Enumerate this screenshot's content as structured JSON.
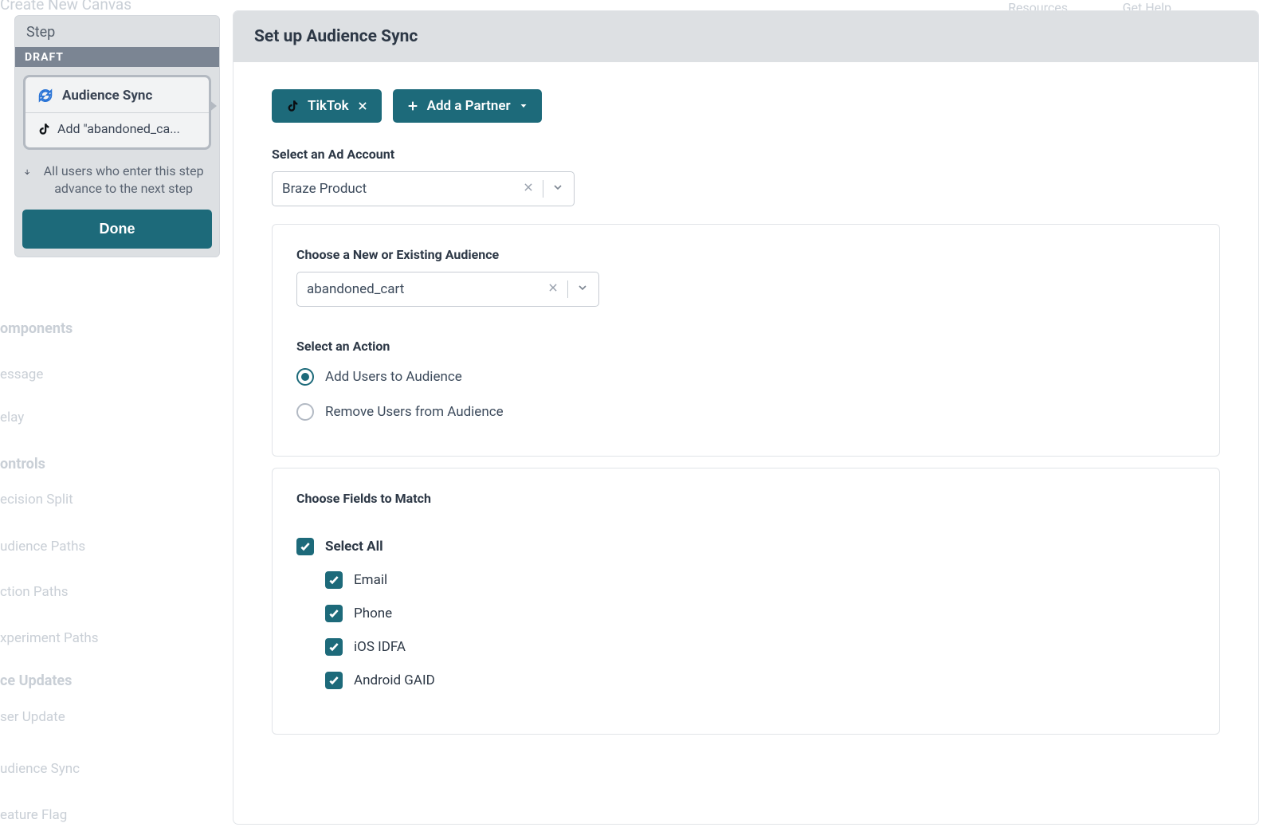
{
  "ghost": {
    "top_left": "Create New Canvas",
    "top_right_1": "Resources",
    "top_right_2": "Get Help",
    "left_items": [
      "omponents",
      "essage",
      "elay",
      "ontrols",
      "ecision Split",
      "udience Paths",
      "ction Paths",
      "xperiment Paths",
      "ce Updates",
      "ser Update",
      "udience Sync",
      "eature Flag"
    ],
    "left_items_bold_idx": 3,
    "left_update_header": "ce Updates",
    "left_components_header": "omponents"
  },
  "step_panel": {
    "header": "Step",
    "draft": "DRAFT",
    "card_title": "Audience Sync",
    "card_subtitle": "Add \"abandoned_ca...",
    "advance_text": "All users who enter this step advance to the next step",
    "done": "Done"
  },
  "main": {
    "title": "Set up Audience Sync",
    "tiktok_label": "TikTok",
    "add_partner_label": "Add a Partner",
    "select_ad_account_label": "Select an Ad Account",
    "ad_account_value": "Braze Product",
    "card1": {
      "choose_audience_label": "Choose a New or Existing Audience",
      "audience_value": "abandoned_cart",
      "select_action_label": "Select an Action",
      "action_add": "Add Users to Audience",
      "action_remove": "Remove Users from Audience",
      "action_selected": "add"
    },
    "card2": {
      "fields_label": "Choose Fields to Match",
      "select_all": "Select All",
      "fields": [
        "Email",
        "Phone",
        "iOS IDFA",
        "Android GAID"
      ]
    }
  }
}
